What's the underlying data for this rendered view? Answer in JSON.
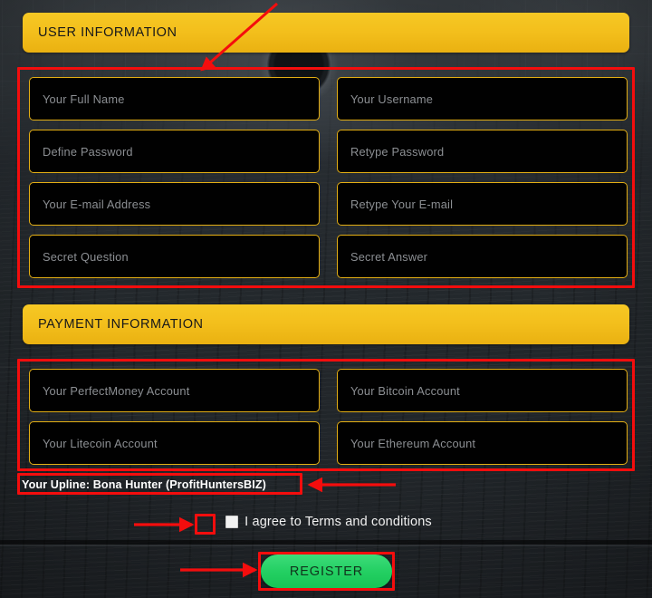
{
  "page": {
    "title": "Registration Form",
    "accent_yellow": "#f3bf1c",
    "field_border": "#e3ae14",
    "annotation_red": "#f40d0d",
    "register_green": "#23cf62",
    "background": "#20252a"
  },
  "sections": [
    {
      "id": "user-information",
      "header": "USER INFORMATION",
      "fields": [
        {
          "name": "full-name",
          "placeholder": "Your Full Name"
        },
        {
          "name": "username",
          "placeholder": "Your Username"
        },
        {
          "name": "define-password",
          "placeholder": "Define Password"
        },
        {
          "name": "retype-password",
          "placeholder": "Retype Password"
        },
        {
          "name": "email",
          "placeholder": "Your E-mail Address"
        },
        {
          "name": "retype-email",
          "placeholder": "Retype Your E-mail"
        },
        {
          "name": "secret-question",
          "placeholder": "Secret Question"
        },
        {
          "name": "secret-answer",
          "placeholder": "Secret Answer"
        }
      ]
    },
    {
      "id": "payment-information",
      "header": "PAYMENT INFORMATION",
      "fields": [
        {
          "name": "perfectmoney-account",
          "placeholder": "Your PerfectMoney Account"
        },
        {
          "name": "bitcoin-account",
          "placeholder": "Your Bitcoin Account"
        },
        {
          "name": "litecoin-account",
          "placeholder": "Your Litecoin Account"
        },
        {
          "name": "ethereum-account",
          "placeholder": "Your Ethereum Account"
        }
      ]
    }
  ],
  "upline": {
    "text": "Your Upline: Bona Hunter (ProfitHuntersBIZ)"
  },
  "terms": {
    "label": "I agree to Terms and conditions",
    "checked": false
  },
  "submit": {
    "label": "REGISTER"
  },
  "annotations": {
    "boxes": [
      {
        "name": "user-fields-highlight",
        "target": "user information input grid"
      },
      {
        "name": "payment-fields-highlight",
        "target": "payment information input grid"
      },
      {
        "name": "upline-highlight",
        "target": "upline text"
      },
      {
        "name": "checkbox-highlight",
        "target": "terms checkbox"
      },
      {
        "name": "register-highlight",
        "target": "register button"
      }
    ],
    "arrows": [
      {
        "name": "arrow-to-user-fields",
        "direction": "down-left"
      },
      {
        "name": "arrow-to-upline",
        "direction": "left"
      },
      {
        "name": "arrow-to-checkbox",
        "direction": "right"
      },
      {
        "name": "arrow-to-register",
        "direction": "right"
      }
    ]
  }
}
